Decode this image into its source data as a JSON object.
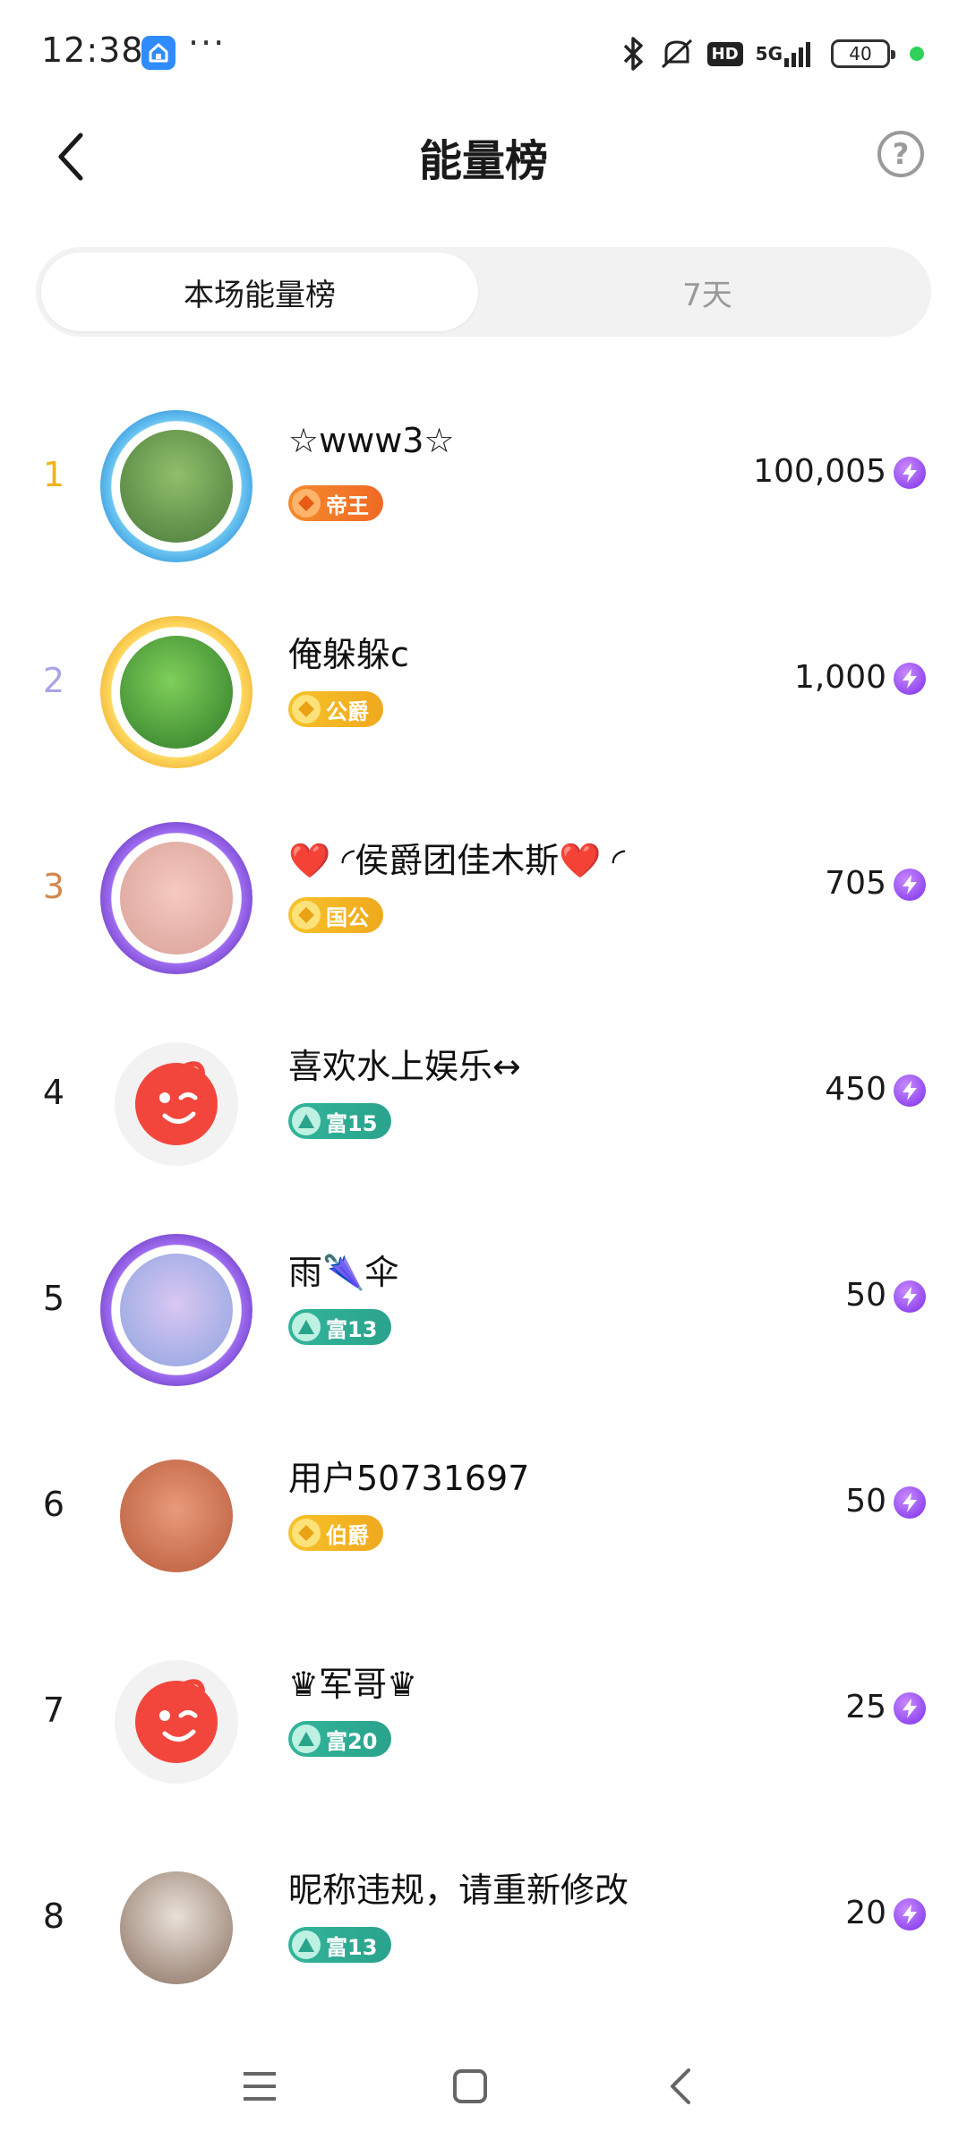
{
  "status_bar": {
    "time": "12:38",
    "dots": "···",
    "network": "5G",
    "hd": "HD",
    "battery": "40",
    "icons": [
      "home-app-icon",
      "bluetooth-icon",
      "mute-icon",
      "signal-icon"
    ]
  },
  "header": {
    "title": "能量榜",
    "help": "?"
  },
  "tabs": {
    "active": "本场能量榜",
    "inactive": "7天"
  },
  "colors": {
    "rank1": "#f0b31b",
    "rank2": "#a9a4e8",
    "rank3": "#d4874d",
    "rank_default": "#1a1a1a",
    "energy": "#8a3ef0"
  },
  "ranking": [
    {
      "rank": "1",
      "name": "☆www3☆",
      "badge": "帝王",
      "badge_style": "orange",
      "score": "100,005"
    },
    {
      "rank": "2",
      "name": "俺躲躲c",
      "badge": "公爵",
      "badge_style": "gold",
      "score": "1,000"
    },
    {
      "rank": "3",
      "name": "❤️ ◜侯爵团佳木斯❤️ ◜",
      "badge": "国公",
      "badge_style": "gold",
      "score": "705"
    },
    {
      "rank": "4",
      "name": "喜欢水上娱乐↔",
      "badge": "富15",
      "badge_style": "teal",
      "score": "450"
    },
    {
      "rank": "5",
      "name": "雨🌂伞",
      "badge": "富13",
      "badge_style": "teal",
      "score": "50"
    },
    {
      "rank": "6",
      "name": "用户50731697",
      "badge": "伯爵",
      "badge_style": "gold",
      "score": "50"
    },
    {
      "rank": "7",
      "name": "♛军哥♛",
      "badge": "富20",
      "badge_style": "teal",
      "score": "25"
    },
    {
      "rank": "8",
      "name": "昵称违规，请重新修改",
      "badge": "富13",
      "badge_style": "teal",
      "score": "20"
    }
  ]
}
